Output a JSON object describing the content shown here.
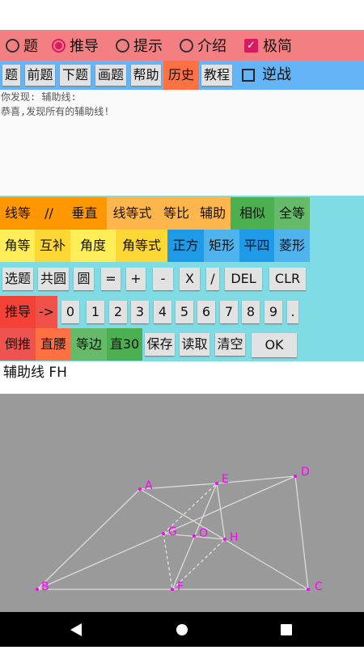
{
  "colors": {
    "mode_bar": "#f47f82",
    "nav_bar": "#63b5f7",
    "keypad_bg": "#7fdbe4",
    "canvas_bg": "#9a9a9a",
    "point_color": "#ff00ff",
    "line_color": "#dcdcdc"
  },
  "mode_bar": {
    "options": [
      {
        "label": "题",
        "selected": false
      },
      {
        "label": "推导",
        "selected": true
      },
      {
        "label": "提示",
        "selected": false
      },
      {
        "label": "介绍",
        "selected": false
      }
    ],
    "checkbox": {
      "label": "极简",
      "checked": true
    }
  },
  "nav_bar": {
    "buttons": [
      "题",
      "前题",
      "下题",
      "画题",
      "帮助",
      "历史",
      "教程"
    ],
    "active": "历史",
    "checkbox": {
      "label": "逆战",
      "checked": false
    }
  },
  "message": {
    "line1": "你发现:  辅助线:",
    "line2": "恭喜,发现所有的辅助线!"
  },
  "keypad": {
    "row1": [
      "线等",
      "//",
      "垂直",
      "线等式",
      "等比",
      "辅助",
      "相似",
      "全等"
    ],
    "row2": [
      "角等",
      "互补",
      "角度",
      "角等式",
      "正方",
      "矩形",
      "平四",
      "菱形"
    ],
    "row3": [
      "选题",
      "共圆",
      "圆",
      "=",
      "+",
      "-",
      "X",
      "/",
      "DEL",
      "CLR"
    ],
    "row4": [
      "推导",
      "->",
      "0",
      "1",
      "2",
      "3",
      "4",
      "5",
      "6",
      "7",
      "8",
      "9",
      "."
    ],
    "row5": [
      "倒推",
      "直腰",
      "等边",
      "直30",
      "保存",
      "读取",
      "清空",
      "OK"
    ]
  },
  "answer": {
    "text": "辅助线  FH"
  },
  "diagram": {
    "points": [
      {
        "label": "A"
      },
      {
        "label": "E"
      },
      {
        "label": "D"
      },
      {
        "label": "G"
      },
      {
        "label": "O"
      },
      {
        "label": "H"
      },
      {
        "label": "B"
      },
      {
        "label": "F"
      },
      {
        "label": "C"
      }
    ]
  },
  "system_nav": {
    "icons": [
      "back-icon",
      "home-icon",
      "recents-icon"
    ]
  }
}
